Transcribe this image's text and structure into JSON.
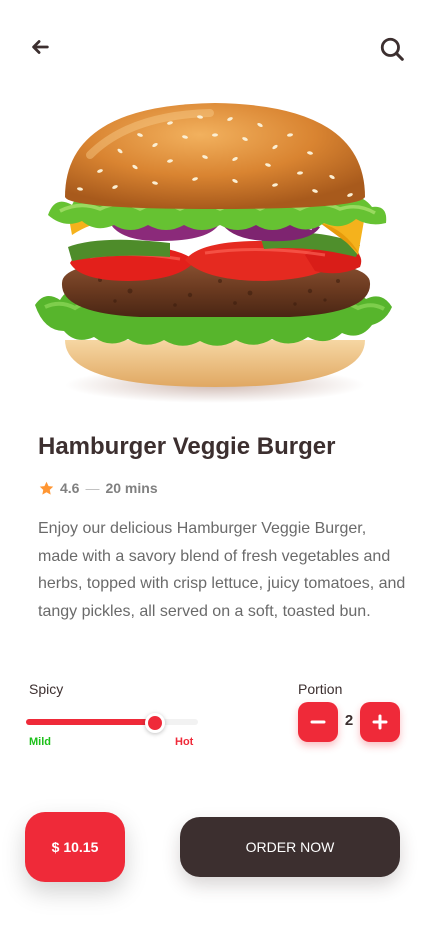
{
  "header": {
    "back_icon": "arrow-left-icon",
    "search_icon": "search-icon"
  },
  "product": {
    "image": "hamburger-photo",
    "name": "Hamburger Veggie Burger",
    "rating": "4.6",
    "time": "20 mins",
    "description": "Enjoy our delicious Hamburger Veggie Burger, made with a savory blend of fresh vegetables and herbs, topped with crisp lettuce, juicy tomatoes, and tangy pickles, all served on a soft, toasted bun."
  },
  "spicy": {
    "label": "Spicy",
    "min_label": "Mild",
    "max_label": "Hot",
    "level": 0.73
  },
  "portion": {
    "label": "Portion",
    "value": "2"
  },
  "footer": {
    "price": "$ 10.15",
    "order_label": "ORDER NOW"
  },
  "colors": {
    "accent": "#ef2a39",
    "dark": "#3c2f2f",
    "mild": "#1cc019",
    "star": "#ff9633"
  }
}
